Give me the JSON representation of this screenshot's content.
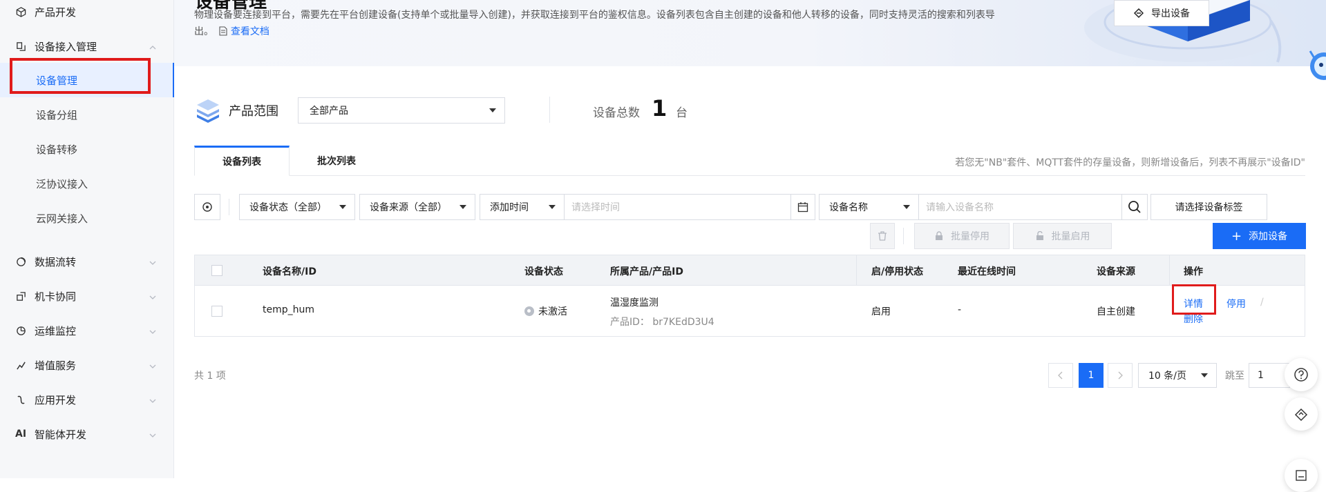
{
  "sidebar": {
    "items": [
      {
        "label": "产品开发",
        "icon": "cube-icon"
      },
      {
        "label": "设备接入管理",
        "icon": "device-access-icon"
      },
      {
        "label": "设备管理"
      },
      {
        "label": "设备分组"
      },
      {
        "label": "设备转移"
      },
      {
        "label": "泛协议接入"
      },
      {
        "label": "云网关接入"
      },
      {
        "label": "数据流转",
        "icon": "data-flow-icon"
      },
      {
        "label": "机卡协同",
        "icon": "card-sync-icon"
      },
      {
        "label": "运维监控",
        "icon": "monitor-icon"
      },
      {
        "label": "增值服务",
        "icon": "value-added-icon"
      },
      {
        "label": "应用开发",
        "icon": "app-dev-icon"
      },
      {
        "label": "智能体开发",
        "icon_text": "AI"
      }
    ]
  },
  "banner": {
    "title_fragment": "设备管理",
    "description": "物理设备要连接到平台，需要先在平台创建设备(支持单个或批量导入创建)，并获取连接到平台的鉴权信息。设备列表包含自主创建的设备和他人转移的设备，同时支持灵活的搜索和列表导出。",
    "doc_link": "查看文档"
  },
  "product_range": {
    "label": "产品范围",
    "selected": "全部产品",
    "total_label": "设备总数",
    "total_value": "1",
    "total_unit": "台"
  },
  "tabs": [
    {
      "label": "设备列表",
      "active": true
    },
    {
      "label": "批次列表",
      "active": false
    }
  ],
  "tab_note": "若您无\"NB\"套件、MQTT套件的存量设备，则新增设备后，列表不再展示\"设备ID\"",
  "filters": {
    "status": "设备状态（全部）",
    "source": "设备来源（全部）",
    "time_type": "添加时间",
    "time_placeholder": "请选择时间",
    "name_type": "设备名称",
    "name_placeholder": "请输入设备名称",
    "tag_placeholder": "请选择设备标签"
  },
  "actions": {
    "batch_disable": "批量停用",
    "batch_enable": "批量启用",
    "export": "导出设备",
    "add": "添加设备"
  },
  "table": {
    "headers": [
      "设备名称/ID",
      "设备状态",
      "所属产品/产品ID",
      "启/停用状态",
      "最近在线时间",
      "设备来源",
      "操作"
    ],
    "rows": [
      {
        "name": "temp_hum",
        "status": "未激活",
        "product": "温湿度监测",
        "product_id_label": "产品ID：",
        "product_id": "br7KEdD3U4",
        "enabled": "启用",
        "last_online": "-",
        "source": "自主创建",
        "op_detail": "详情",
        "op_disable": "停用",
        "op_sep": "/",
        "op_delete": "删除"
      }
    ]
  },
  "pagination": {
    "total": "共 1 项",
    "current": "1",
    "page_size": "10 条/页",
    "jump_label": "跳至",
    "jump_value": "1"
  },
  "colors": {
    "accent": "#1a6cf6",
    "highlight": "#e01b1b"
  }
}
